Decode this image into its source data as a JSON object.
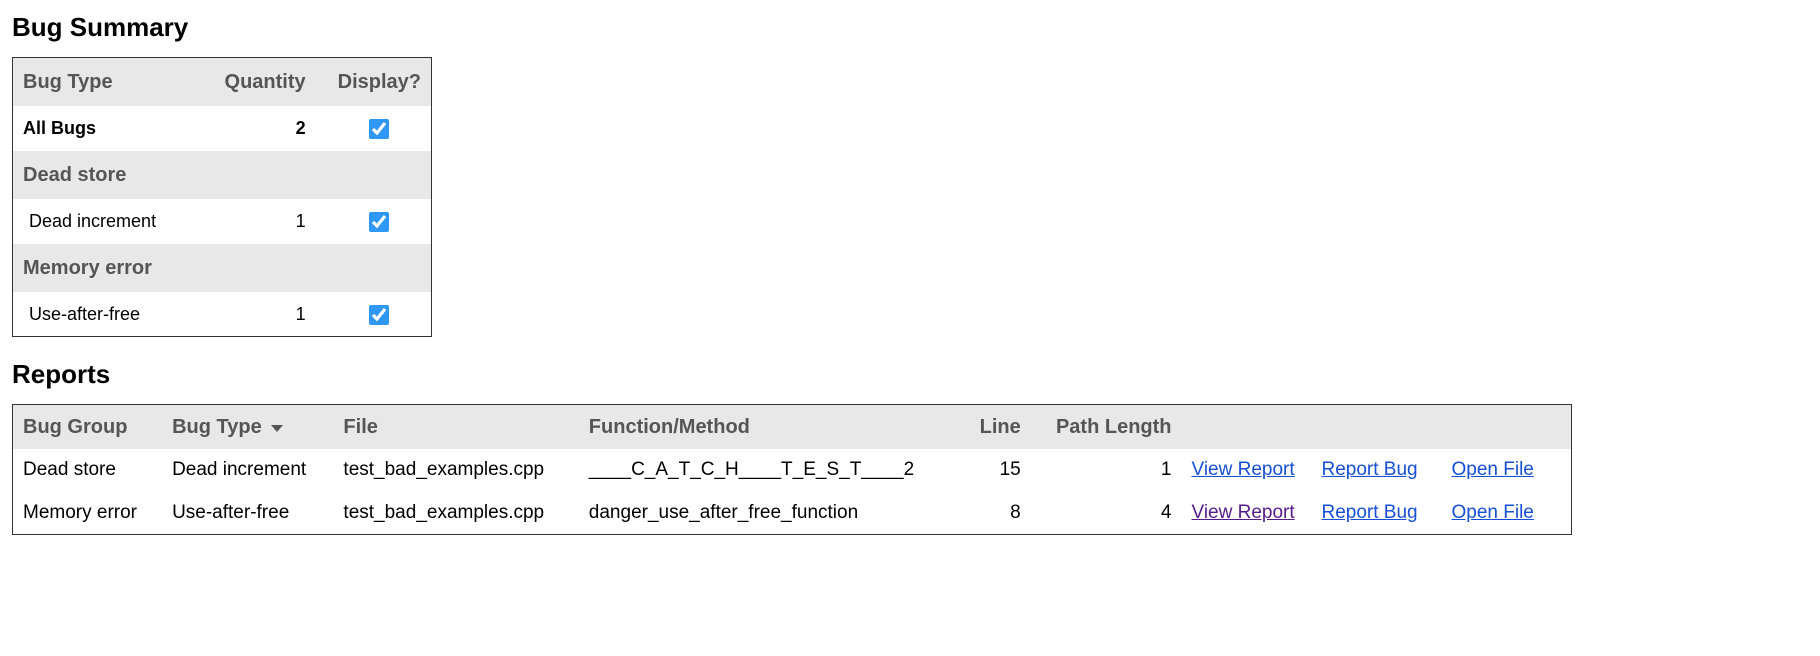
{
  "summary": {
    "heading": "Bug Summary",
    "headers": {
      "type": "Bug Type",
      "quantity": "Quantity",
      "display": "Display?"
    },
    "all_bugs": {
      "label": "All Bugs",
      "quantity": "2",
      "checked": true
    },
    "categories": [
      {
        "name": "Dead store",
        "items": [
          {
            "name": "Dead increment",
            "quantity": "1",
            "checked": true
          }
        ]
      },
      {
        "name": "Memory error",
        "items": [
          {
            "name": "Use-after-free",
            "quantity": "1",
            "checked": true
          }
        ]
      }
    ]
  },
  "reports": {
    "heading": "Reports",
    "headers": {
      "group": "Bug Group",
      "type": "Bug Type",
      "file": "File",
      "func": "Function/Method",
      "line": "Line",
      "path_len": "Path Length"
    },
    "sort_column": "type",
    "link_labels": {
      "view": "View Report",
      "report": "Report Bug",
      "open": "Open File"
    },
    "rows": [
      {
        "group": "Dead store",
        "type": "Dead increment",
        "file": "test_bad_examples.cpp",
        "func": "____C_A_T_C_H____T_E_S_T____2",
        "line": "15",
        "path_len": "1",
        "visited": false
      },
      {
        "group": "Memory error",
        "type": "Use-after-free",
        "file": "test_bad_examples.cpp",
        "func": "danger_use_after_free_function",
        "line": "8",
        "path_len": "4",
        "visited": true
      }
    ]
  }
}
